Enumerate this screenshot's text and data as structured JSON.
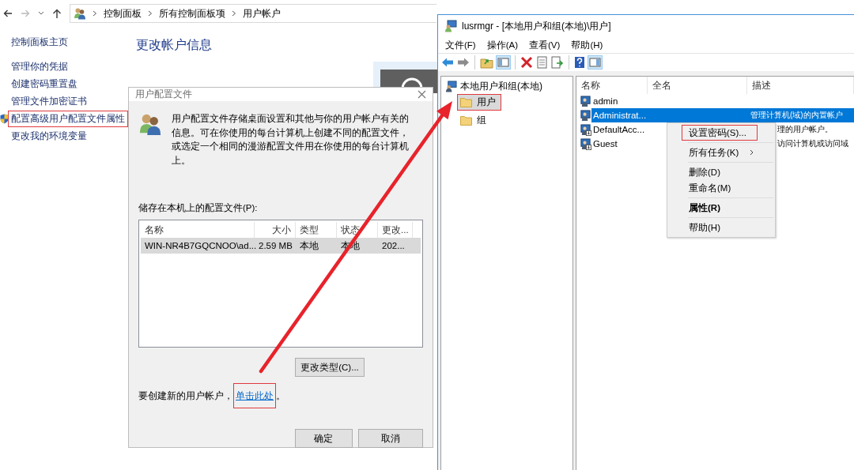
{
  "address_bar": {
    "crumbs": [
      "控制面板",
      "所有控制面板项",
      "用户帐户"
    ]
  },
  "sidebar": {
    "items": [
      {
        "label": "控制面板主页",
        "shield": false,
        "highlighted": false
      },
      {
        "label": "管理你的凭据",
        "shield": false,
        "highlighted": false
      },
      {
        "label": "创建密码重置盘",
        "shield": false,
        "highlighted": false
      },
      {
        "label": "管理文件加密证书",
        "shield": false,
        "highlighted": false
      },
      {
        "label": "配置高级用户配置文件属性",
        "shield": true,
        "highlighted": true
      },
      {
        "label": "更改我的环境变量",
        "shield": false,
        "highlighted": false
      }
    ]
  },
  "main": {
    "heading": "更改帐户信息"
  },
  "profile_dialog": {
    "title": "用户配置文件",
    "description": "用户配置文件存储桌面设置和其他与你的用户帐户有关的信息。可在你使用的每台计算机上创建不同的配置文件，或选定一个相同的漫游配置文件用在你使用的每台计算机上。",
    "list_label": "储存在本机上的配置文件(P):",
    "columns": [
      "名称",
      "大小",
      "类型",
      "状态",
      "更改..."
    ],
    "rows": [
      {
        "cells": [
          "WIN-NR4B7GQCNOO\\ad...",
          "2.59 MB",
          "本地",
          "本地",
          "202..."
        ],
        "selected": true
      }
    ],
    "change_type_button": "更改类型(C)...",
    "create_text": "要创建新的用户帐户，",
    "create_link": {
      "label": "单击此处",
      "highlighted": true
    },
    "create_end": "。",
    "buttons": [
      "确定",
      "取消"
    ]
  },
  "lusrmgr": {
    "title": "lusrmgr - [本地用户和组(本地)\\用户]",
    "menu": [
      "文件(F)",
      "操作(A)",
      "查看(V)",
      "帮助(H)"
    ],
    "tree": {
      "label": "本地用户和组(本地)",
      "children": [
        {
          "label": "用户",
          "selected": true,
          "highlighted": true
        },
        {
          "label": "组",
          "selected": false,
          "highlighted": false
        }
      ]
    },
    "columns": [
      "名称",
      "全名",
      "描述"
    ],
    "users": [
      {
        "name": "admin",
        "disabled": false,
        "selected": false
      },
      {
        "name": "Administrat...",
        "description": "管理计算机(域)的内置帐户",
        "disabled": false,
        "selected": true
      },
      {
        "name": "DefaultAcc...",
        "description": "理的用户帐户。",
        "disabled": true,
        "selected": false
      },
      {
        "name": "Guest",
        "description": "访问计算机或访问域",
        "disabled": true,
        "selected": false
      }
    ],
    "context_menu": {
      "items": [
        {
          "kind": "item",
          "label": "设置密码(S)...",
          "highlighted": true
        },
        {
          "kind": "separator"
        },
        {
          "kind": "submenu",
          "label": "所有任务(K)",
          "highlighted": false
        },
        {
          "kind": "separator"
        },
        {
          "kind": "item",
          "label": "删除(D)",
          "highlighted": false
        },
        {
          "kind": "item",
          "label": "重命名(M)",
          "highlighted": false
        },
        {
          "kind": "separator"
        },
        {
          "kind": "default",
          "label": "属性(R)",
          "highlighted": false
        },
        {
          "kind": "separator"
        },
        {
          "kind": "item",
          "label": "帮助(H)",
          "highlighted": false
        }
      ]
    }
  }
}
